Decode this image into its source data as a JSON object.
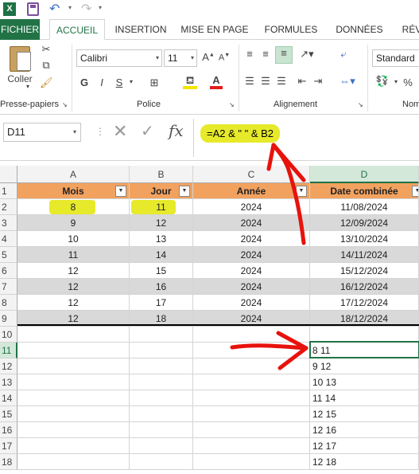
{
  "qat": {
    "app_icon": "X",
    "undo_caret": "▾",
    "redo_caret": "▾"
  },
  "tabs": [
    "FICHIER",
    "ACCUEIL",
    "INSERTION",
    "MISE EN PAGE",
    "FORMULES",
    "DONNÉES",
    "RÉV"
  ],
  "ribbon": {
    "paste_label": "Coller",
    "clipboard_label": "Presse-papiers",
    "font_name": "Calibri",
    "font_size": "11",
    "bold": "G",
    "italic": "I",
    "underline": "S",
    "font_label": "Police",
    "align_label": "Alignement",
    "number_format": "Standard",
    "percent": "%",
    "number_label": "Nom"
  },
  "formula_bar": {
    "name_box": "D11",
    "formula": "=A2 & \" \" & B2"
  },
  "columns": [
    "A",
    "B",
    "C",
    "D"
  ],
  "rows": [
    "1",
    "2",
    "3",
    "4",
    "5",
    "6",
    "7",
    "8",
    "9",
    "10",
    "11",
    "12",
    "13",
    "14",
    "15",
    "16",
    "17",
    "18"
  ],
  "table": {
    "headers": [
      "Mois",
      "Jour",
      "Année",
      "Date combinée"
    ],
    "rows": [
      [
        "8",
        "11",
        "2024",
        "11/08/2024"
      ],
      [
        "9",
        "12",
        "2024",
        "12/09/2024"
      ],
      [
        "10",
        "13",
        "2024",
        "13/10/2024"
      ],
      [
        "11",
        "14",
        "2024",
        "14/11/2024"
      ],
      [
        "12",
        "15",
        "2024",
        "15/12/2024"
      ],
      [
        "12",
        "16",
        "2024",
        "16/12/2024"
      ],
      [
        "12",
        "17",
        "2024",
        "17/12/2024"
      ],
      [
        "12",
        "18",
        "2024",
        "18/12/2024"
      ]
    ]
  },
  "results": [
    "8 11",
    "9 12",
    "10 13",
    "11 14",
    "12 15",
    "12 16",
    "12 17",
    "12 18"
  ],
  "colors": {
    "accent": "#217346",
    "header_fill": "#f2a25f",
    "highlight": "#e6ea2a",
    "annotation": "#e8120c"
  }
}
